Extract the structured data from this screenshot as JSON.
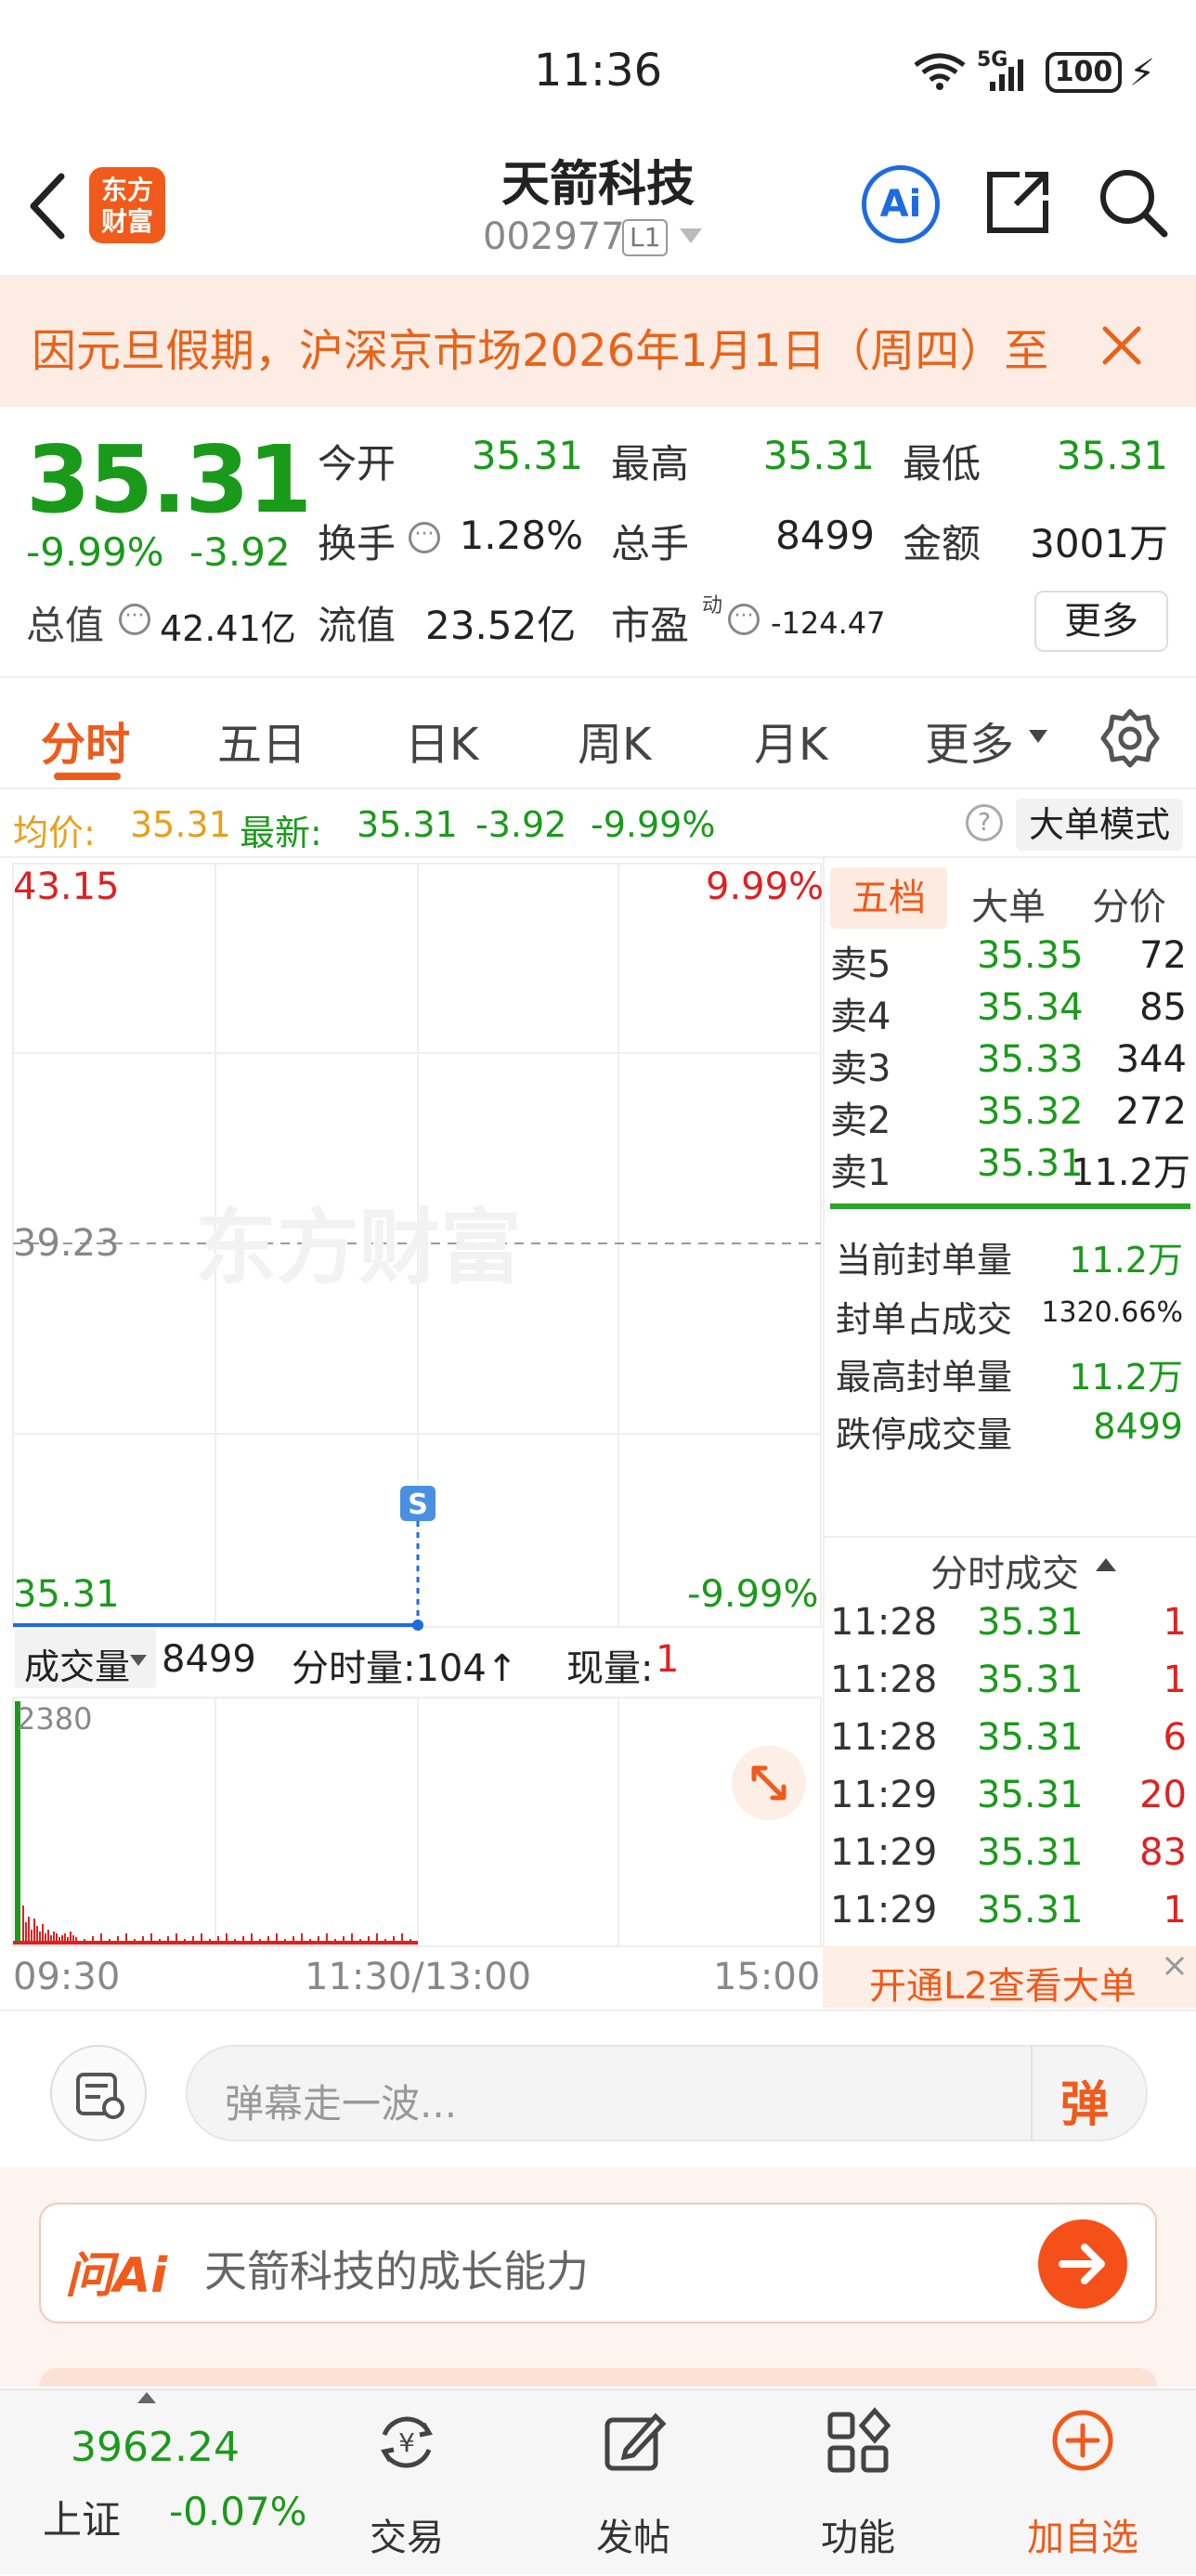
{
  "status": {
    "time": "11:36",
    "network": "5G",
    "battery": "100"
  },
  "header": {
    "logo_line1": "东方",
    "logo_line2": "财富",
    "title": "天箭科技",
    "code": "002977",
    "level": "L1",
    "ai_label": "Ai"
  },
  "notice": {
    "text": "因元旦假期，沪深京市场2026年1月1日（周四）至"
  },
  "quote": {
    "price": "35.31",
    "change_pct": "-9.99%",
    "change": "-3.92",
    "open_label": "今开",
    "open": "35.31",
    "high_label": "最高",
    "high": "35.31",
    "low_label": "最低",
    "low": "35.31",
    "turnover_label": "换手",
    "turnover": "1.28%",
    "volume_label": "总手",
    "volume": "8499",
    "amount_label": "金额",
    "amount": "3001万",
    "mktcap_label": "总值",
    "mktcap": "42.41亿",
    "float_label": "流值",
    "float": "23.52亿",
    "pe_label": "市盈",
    "pe_sup": "动",
    "pe": "-124.47",
    "more_button": "更多"
  },
  "tabs": [
    "分时",
    "五日",
    "日K",
    "周K",
    "月K",
    "更多"
  ],
  "infobar": {
    "avg_label": "均价:",
    "avg": "35.31",
    "latest_label": "最新:",
    "latest": "35.31",
    "change": "-3.92",
    "change_pct": "-9.99%",
    "mode_button": "大单模式"
  },
  "chart": {
    "price_top": "43.15",
    "pct_top": "9.99%",
    "price_mid": "39.23",
    "price_bottom": "35.31",
    "pct_bottom": "-9.99%",
    "watermark": "东方财富",
    "marker": "S",
    "vol_label": "成交量",
    "vol_value": "8499",
    "tick_label": "分时量:104↑",
    "now_label": "现量:",
    "now_value": "1",
    "vol_max": "2380",
    "time_start": "09:30",
    "time_mid": "11:30/13:00",
    "time_end": "15:00"
  },
  "chart_data": {
    "type": "line",
    "x": [
      "09:30",
      "11:30/13:00",
      "15:00"
    ],
    "series": [
      {
        "values": [
          35.31,
          35.31
        ]
      }
    ],
    "ylim": [
      35.31,
      43.15
    ],
    "volume_ylim": [
      0,
      2380
    ]
  },
  "orderbook": {
    "tabs": [
      "五档",
      "大单",
      "分价"
    ],
    "asks": [
      {
        "label": "卖5",
        "price": "35.35",
        "qty": "72"
      },
      {
        "label": "卖4",
        "price": "35.34",
        "qty": "85"
      },
      {
        "label": "卖3",
        "price": "35.33",
        "qty": "344"
      },
      {
        "label": "卖2",
        "price": "35.32",
        "qty": "272"
      },
      {
        "label": "卖1",
        "price": "35.31",
        "qty": "11.2万"
      }
    ],
    "stats": [
      {
        "label": "当前封单量",
        "value": "11.2万"
      },
      {
        "label": "封单占成交",
        "value": "1320.66%"
      },
      {
        "label": "最高封单量",
        "value": "11.2万"
      },
      {
        "label": "跌停成交量",
        "value": "8499"
      }
    ],
    "trades_title": "分时成交",
    "trades": [
      {
        "time": "11:28",
        "price": "35.31",
        "qty": "1"
      },
      {
        "time": "11:28",
        "price": "35.31",
        "qty": "1"
      },
      {
        "time": "11:28",
        "price": "35.31",
        "qty": "6"
      },
      {
        "time": "11:29",
        "price": "35.31",
        "qty": "20"
      },
      {
        "time": "11:29",
        "price": "35.31",
        "qty": "83"
      },
      {
        "time": "11:29",
        "price": "35.31",
        "qty": "1"
      }
    ],
    "l2_banner": "开通L2查看大单"
  },
  "danmu": {
    "placeholder": "弹幕走一波...",
    "send": "弹"
  },
  "askai": {
    "brand": "问Ai",
    "query": "天箭科技的成长能力"
  },
  "bottomnav": {
    "index_value": "3962.24",
    "index_name": "上证",
    "index_change": "-0.07%",
    "trade": "交易",
    "post": "发帖",
    "function": "功能",
    "add": "加自选"
  },
  "colors": {
    "up": "#e02020",
    "down": "#1a9a1a",
    "accent": "#f05a1a",
    "blue": "#1e6be0"
  }
}
